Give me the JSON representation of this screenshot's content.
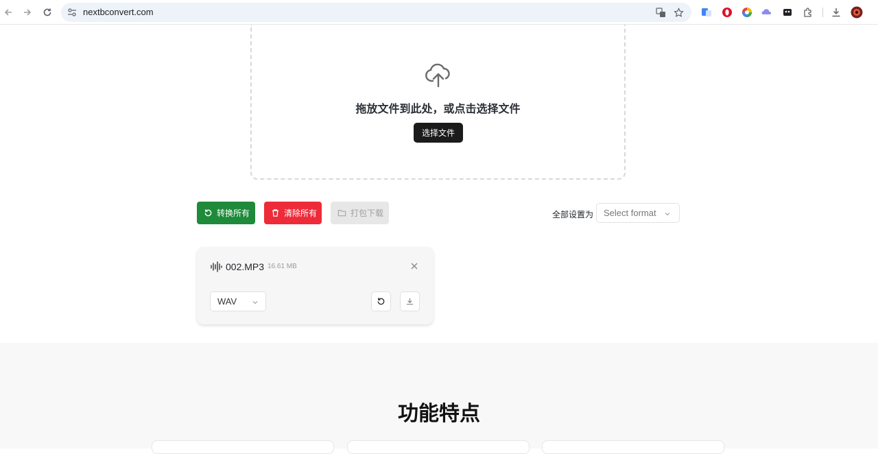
{
  "browser": {
    "url": "nextbconvert.com"
  },
  "dropzone": {
    "prompt": "拖放文件到此处，或点击选择文件",
    "select_button": "选择文件"
  },
  "actions": {
    "convert_all": "转换所有",
    "clear_all": "清除所有",
    "zip_download": "打包下载",
    "set_all_label": "全部设置为",
    "format_placeholder": "Select format"
  },
  "files": [
    {
      "name": "002.MP3",
      "size": "16.61 MB",
      "target_format": "WAV"
    }
  ],
  "features": {
    "title": "功能特点"
  },
  "colors": {
    "convert": "#1e8a3a",
    "clear": "#ee2b39",
    "disabled": "#e7e7e7",
    "primary_dark": "#1b1b1b"
  }
}
